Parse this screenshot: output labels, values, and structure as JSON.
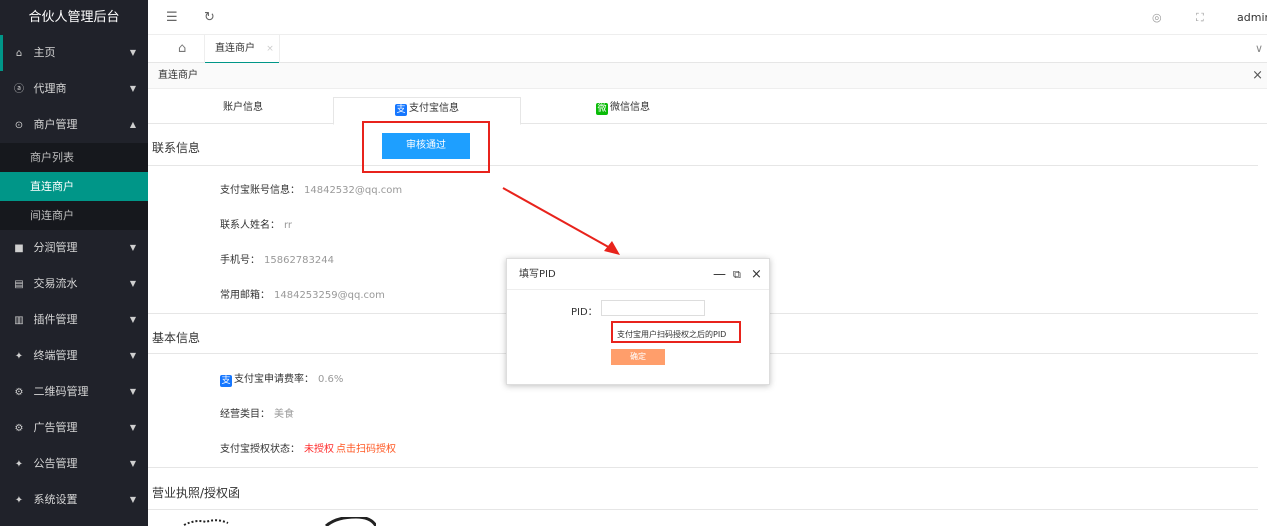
{
  "sidebar": {
    "title": "合伙人管理后台",
    "items": [
      {
        "icon": "home-icon",
        "glyph": "⌂",
        "label": "主页"
      },
      {
        "icon": "agent-icon",
        "glyph": "ⓐ",
        "label": "代理商"
      },
      {
        "icon": "merchant-icon",
        "glyph": "⊙",
        "label": "商户管理"
      },
      {
        "icon": "profit-icon",
        "glyph": "■",
        "label": "分润管理"
      },
      {
        "icon": "transaction-icon",
        "glyph": "▤",
        "label": "交易流水"
      },
      {
        "icon": "plugin-icon",
        "glyph": "▥",
        "label": "插件管理"
      },
      {
        "icon": "terminal-icon",
        "glyph": "✦",
        "label": "终端管理"
      },
      {
        "icon": "qrcode-icon",
        "glyph": "⚙",
        "label": "二维码管理"
      },
      {
        "icon": "ad-icon",
        "glyph": "⚙",
        "label": "广告管理"
      },
      {
        "icon": "notice-icon",
        "glyph": "✦",
        "label": "公告管理"
      },
      {
        "icon": "settings-icon",
        "glyph": "✦",
        "label": "系统设置"
      }
    ],
    "subitems": [
      {
        "label": "商户列表",
        "active": false
      },
      {
        "label": "直连商户",
        "active": true
      },
      {
        "label": "间连商户",
        "active": false
      }
    ]
  },
  "topbar": {
    "menu_icon": "☰",
    "refresh_icon": "↻",
    "theme_icon": "◎",
    "fullscreen_icon": "⛶",
    "user": "admin"
  },
  "tabsbar": {
    "home_icon": "⌂",
    "tab_label": "直连商户",
    "tab_close": "×",
    "more_icon": "∨"
  },
  "content": {
    "crumb": "直连商户",
    "close_icon": "×",
    "tabs": {
      "account": "账户信息",
      "alipay_badge": "支",
      "alipay": "支付宝信息",
      "wechat_badge": "微",
      "wechat": "微信信息"
    },
    "approve_button": "审核通过",
    "contact_title": "联系信息",
    "contact": {
      "alipay_account_label": "支付宝账号信息：",
      "alipay_account_value": "14842532@qq.com",
      "name_label": "联系人姓名：",
      "name_value": "rr",
      "phone_label": "手机号：",
      "phone_value": "15862783244",
      "email_label": "常用邮箱：",
      "email_value": "1484253259@qq.com"
    },
    "basic_title": "基本信息",
    "basic": {
      "rate_badge": "支",
      "rate_label": "支付宝申请费率：",
      "rate_value": "0.6%",
      "category_label": "经营类目：",
      "category_value": "美食",
      "auth_label": "支付宝授权状态：",
      "auth_value": "未授权",
      "auth_link": "点击扫码授权"
    },
    "license_title": "营业执照/授权函"
  },
  "dialog": {
    "title": "填写PID",
    "min_icon": "—",
    "max_icon": "⧉",
    "close_icon": "×",
    "pid_label": "PID：",
    "pid_value": "",
    "hint": "支付宝用户扫码授权之后的PID",
    "ok": "确定"
  },
  "colors": {
    "sidebar_bg": "#20222a",
    "accent": "#009688",
    "primary_button": "#1e9fff",
    "annotation_red": "#e8231c",
    "ok_button": "#ff9e6b"
  }
}
